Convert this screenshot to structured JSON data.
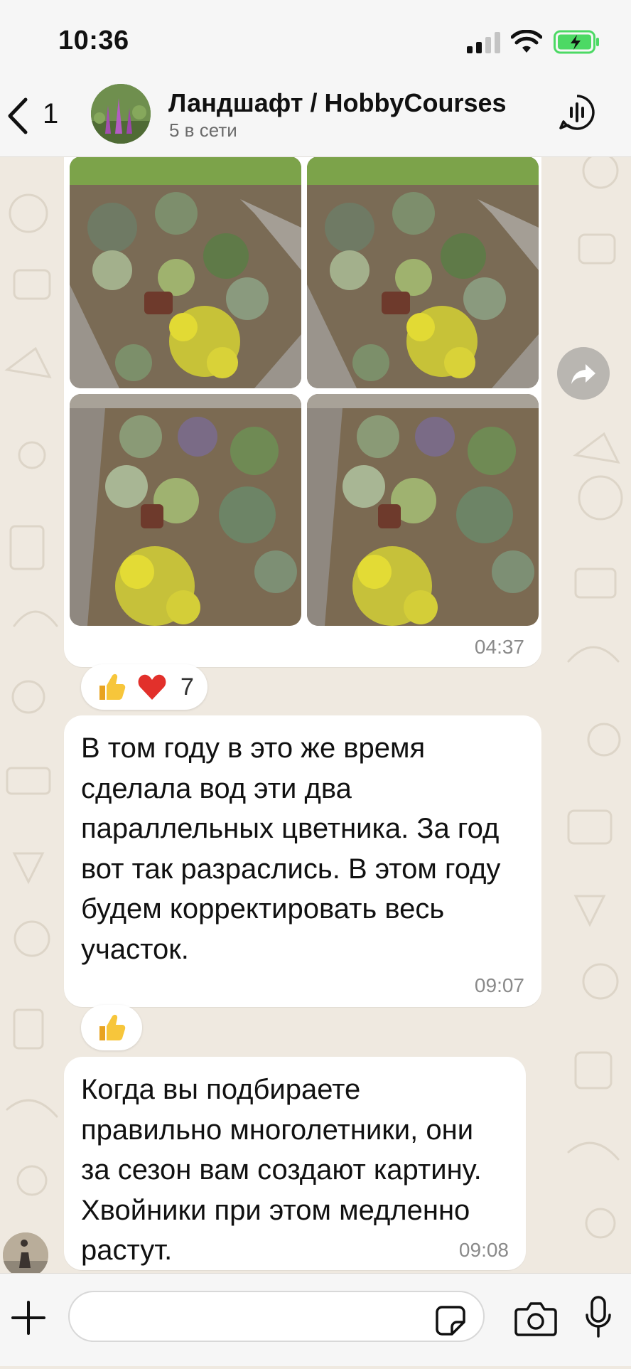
{
  "status_bar": {
    "time": "10:36"
  },
  "header": {
    "back_count": "1",
    "title": "Ландшафт / HobbyCourses",
    "subtitle": "5 в сети"
  },
  "messages": [
    {
      "type": "photos",
      "photo_count": 4,
      "time": "04:37"
    },
    {
      "type": "text",
      "text": "В том году в это же время сделала вод эти два параллельных цветника. За год вот так разраслись. В этом году будем корректировать весь участок.",
      "time": "09:07"
    },
    {
      "type": "text",
      "text": "Когда вы подбираете правильно многолетники, они за сезон вам создают картину. Хвойники при этом медленно растут.",
      "time": "09:08"
    }
  ],
  "reactions": [
    {
      "emojis": [
        "thumbs-up",
        "red-heart"
      ],
      "count": "7"
    },
    {
      "emojis": [
        "thumbs-up"
      ]
    }
  ],
  "composer": {
    "placeholder": ""
  },
  "colors": {
    "bubble": "#ffffff",
    "wallpaper": "#efe9e0",
    "battery_charging": "#4cd964"
  }
}
